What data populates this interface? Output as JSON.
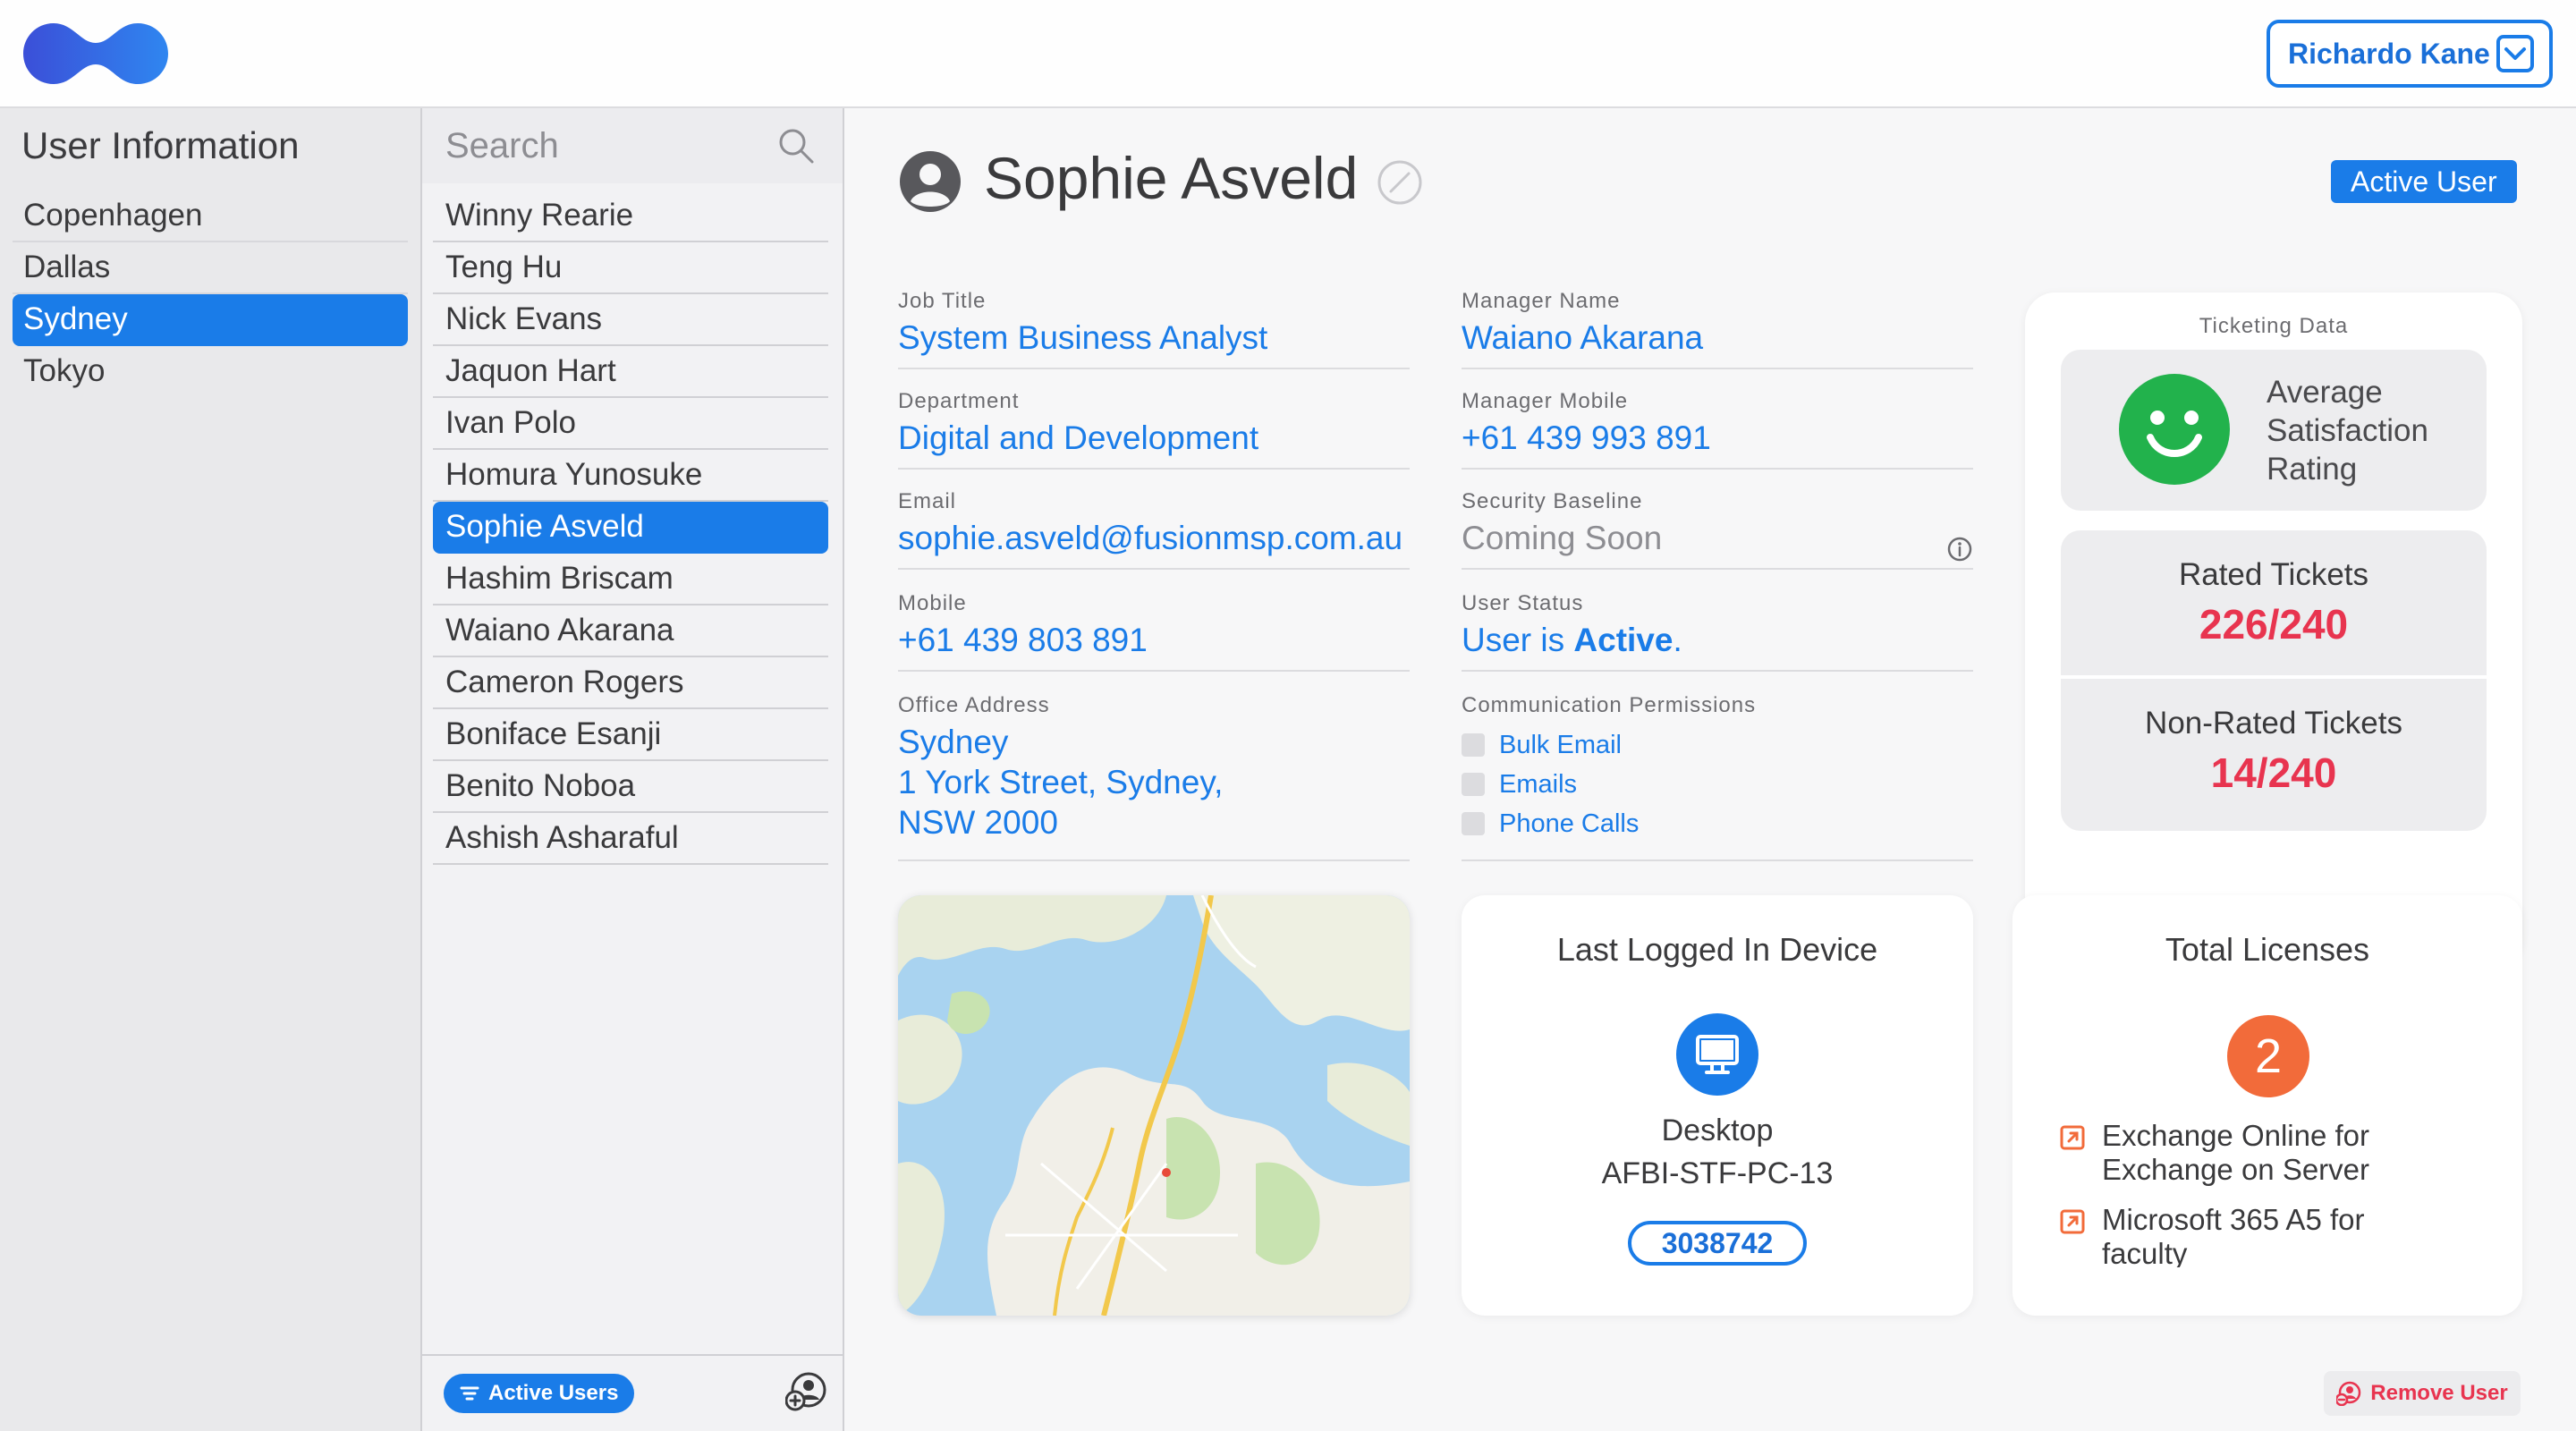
{
  "header": {
    "user_name": "Richardo Kane",
    "brand_color": "#1a7ce8"
  },
  "sidebar": {
    "title": "User Information",
    "items": [
      {
        "label": "Copenhagen",
        "selected": false
      },
      {
        "label": "Dallas",
        "selected": false
      },
      {
        "label": "Sydney",
        "selected": true
      },
      {
        "label": "Tokyo",
        "selected": false
      }
    ]
  },
  "userlist": {
    "search_placeholder": "Search",
    "users": [
      "Winny Rearie",
      "Teng Hu",
      "Nick Evans",
      "Jaquon Hart",
      "Ivan Polo",
      "Homura Yunosuke",
      "Sophie Asveld",
      "Hashim Briscam",
      "Waiano Akarana",
      "Cameron Rogers",
      "Boniface Esanji",
      "Benito Noboa",
      "Ashish Asharaful"
    ],
    "selected_user": "Sophie Asveld",
    "filter_label": "Active Users"
  },
  "profile": {
    "name": "Sophie Asveld",
    "status_badge": "Active User",
    "job_title_label": "Job Title",
    "job_title": "System Business Analyst",
    "department_label": "Department",
    "department": "Digital and Development",
    "email_label": "Email",
    "email": "sophie.asveld@fusionmsp.com.au",
    "mobile_label": "Mobile",
    "mobile": "+61 439 803 891",
    "office_label": "Office Address",
    "office_city": "Sydney",
    "office_line1": "1 York Street, Sydney,",
    "office_line2": "NSW 2000",
    "manager_name_label": "Manager Name",
    "manager_name": "Waiano Akarana",
    "manager_mobile_label": "Manager Mobile",
    "manager_mobile": "+61 439 993 891",
    "security_label": "Security Baseline",
    "security_value": "Coming Soon",
    "user_status_label": "User Status",
    "user_status_prefix": "User is ",
    "user_status_value": "Active",
    "user_status_suffix": ".",
    "comm_label": "Communication Permissions",
    "comm_permissions": [
      "Bulk Email",
      "Emails",
      "Phone Calls"
    ]
  },
  "ticketing": {
    "title": "Ticketing Data",
    "satisfaction_line1": "Average",
    "satisfaction_line2": "Satisfaction",
    "satisfaction_line3": "Rating",
    "rated_label": "Rated Tickets",
    "rated_value": "226/240",
    "nonrated_label": "Non-Rated Tickets",
    "nonrated_value": "14/240",
    "accent_color": "#e8344f",
    "smiley_color": "#22b24c"
  },
  "device": {
    "title": "Last Logged In Device",
    "type": "Desktop",
    "name": "AFBI-STF-PC-13",
    "id": "3038742"
  },
  "licenses": {
    "title": "Total Licenses",
    "count": "2",
    "items": [
      {
        "line1": "Exchange Online for",
        "line2": "Exchange on Server"
      },
      {
        "line1": "Microsoft 365 A5 for",
        "line2": "faculty"
      }
    ]
  },
  "actions": {
    "remove_user": "Remove User"
  }
}
